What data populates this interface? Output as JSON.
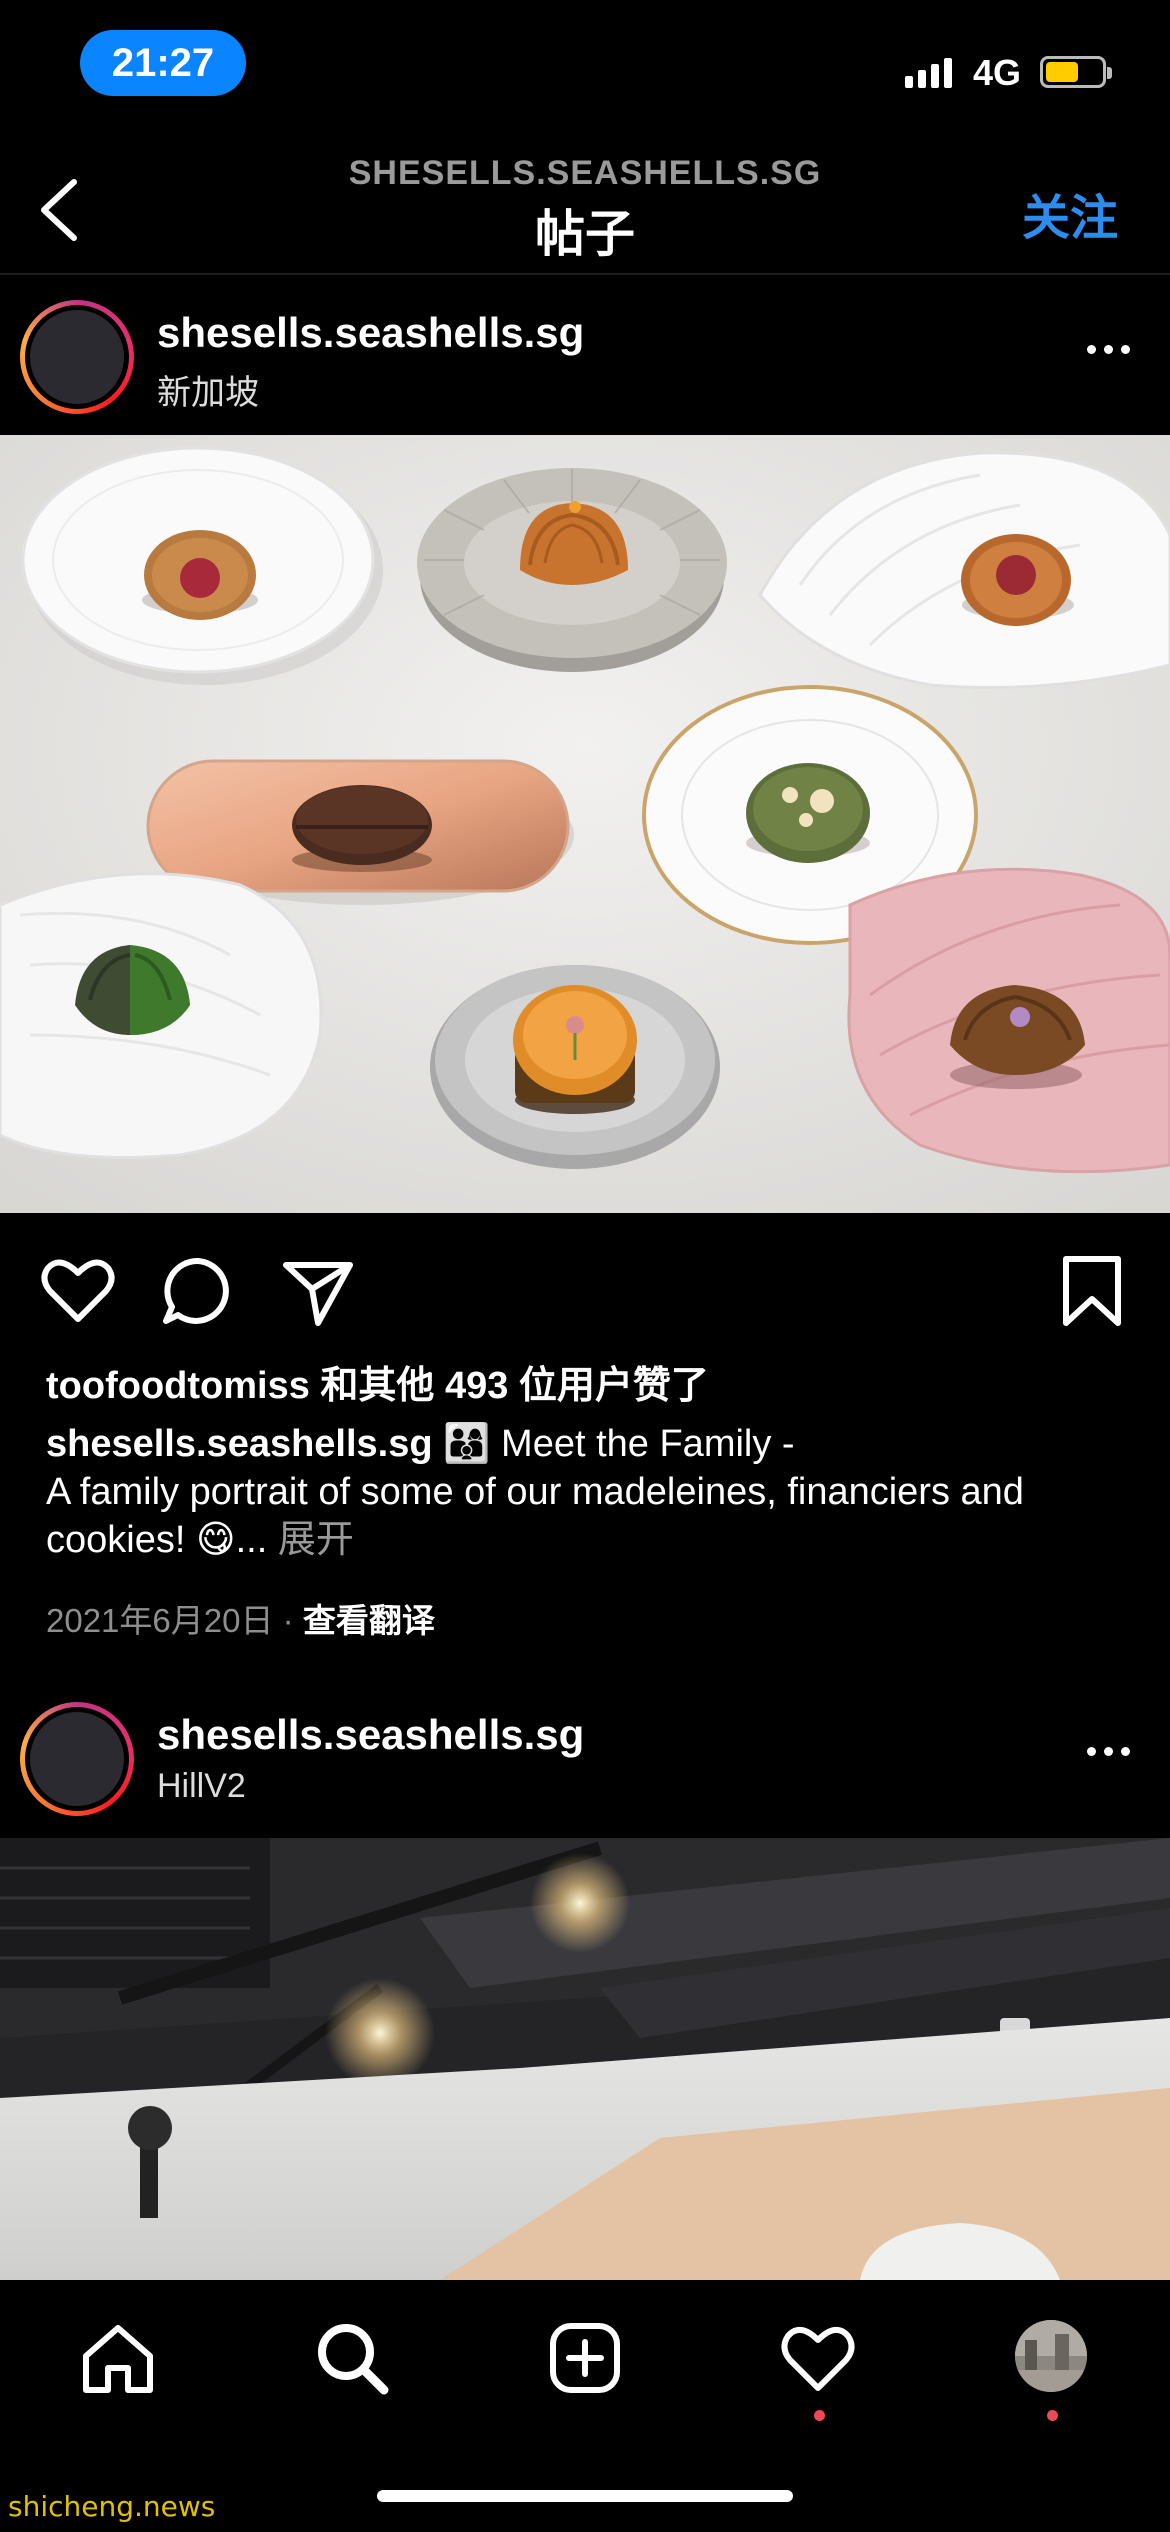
{
  "status_bar": {
    "time": "21:27",
    "network": "4G"
  },
  "nav": {
    "subtitle": "SHESELLS.SEASHELLS.SG",
    "title": "帖子",
    "follow_label": "关注"
  },
  "post1": {
    "username": "shesells.seashells.sg",
    "location": "新加坡",
    "likes_text": "toofoodtomiss 和其他 493 位用户赞了",
    "caption_username": "shesells.seashells.sg",
    "caption_emoji": "👨‍👩‍👦",
    "caption_text": "Meet the Family -\nA family portrait of some of our madeleines, financiers and cookies!",
    "caption_end_emoji": "😋",
    "ellipsis": "...",
    "more_label": "展开",
    "date": "2021年6月20日",
    "separator": "·",
    "translate_label": "查看翻译"
  },
  "post2": {
    "username": "shesells.seashells.sg",
    "location": "HillV2"
  },
  "tabbar": {
    "items": [
      "home-icon",
      "search-icon",
      "create-icon",
      "activity-icon",
      "profile-avatar"
    ],
    "notification_color": "#ed4956"
  },
  "watermark": "shicheng.news",
  "colors": {
    "accent": "#0a84ff",
    "follow": "#2d8cf0",
    "battery": "#ffcc00"
  }
}
